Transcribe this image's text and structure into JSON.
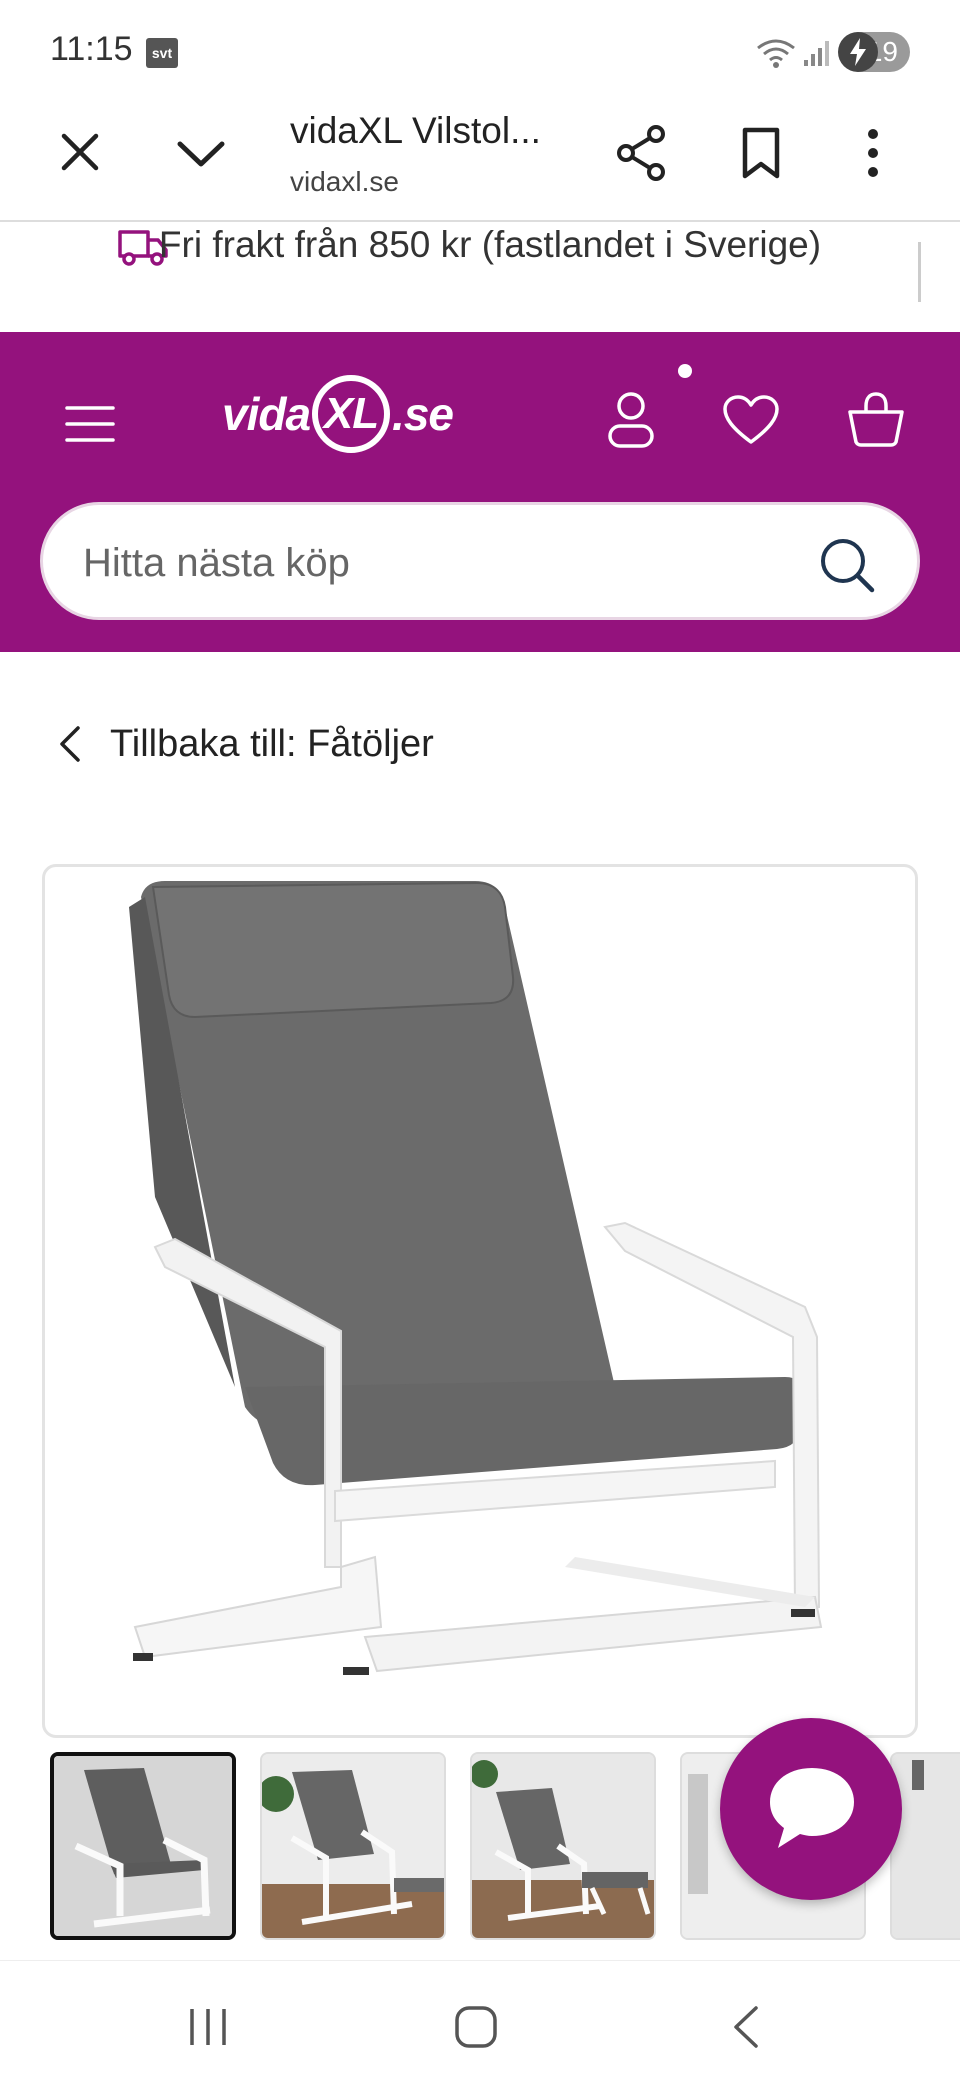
{
  "status_bar": {
    "time": "11:15",
    "svt_badge": "svt",
    "battery": "19",
    "icons": [
      "wifi-icon",
      "signal-icon",
      "battery-charging-icon"
    ]
  },
  "browser": {
    "page_title": "vidaXL Vilstol...",
    "domain": "vidaxl.se",
    "icons": [
      "close-icon",
      "chevron-down-icon",
      "share-icon",
      "bookmark-icon",
      "more-vertical-icon"
    ]
  },
  "shipping_banner": {
    "text": "Fri frakt från 850 kr (fastlandet i Sverige)",
    "icon": "delivery-truck-icon"
  },
  "header": {
    "logo": {
      "part1": "vida",
      "part2": "XL",
      "part3": ".se"
    },
    "search_placeholder": "Hitta nästa köp",
    "icons": [
      "menu-icon",
      "account-icon",
      "wishlist-icon",
      "cart-icon",
      "search-icon"
    ]
  },
  "breadcrumb": {
    "back_label": "Tillbaka till: Fåtöljer"
  },
  "product_gallery": {
    "main_image": "gray-armchair-white-frame",
    "thumbnails": [
      "armchair-front",
      "armchair-with-plant",
      "armchair-with-footstool",
      "armchair-detail",
      "armchair-extra"
    ],
    "active_index": 0
  },
  "colors": {
    "brand": "#94127d",
    "cushion": "#6b6b6b",
    "frame": "#ffffff"
  },
  "chat": {
    "icon": "chat-bubble-icon"
  },
  "nav_bar": {
    "icons": [
      "recent-apps-icon",
      "home-icon",
      "back-icon"
    ]
  }
}
